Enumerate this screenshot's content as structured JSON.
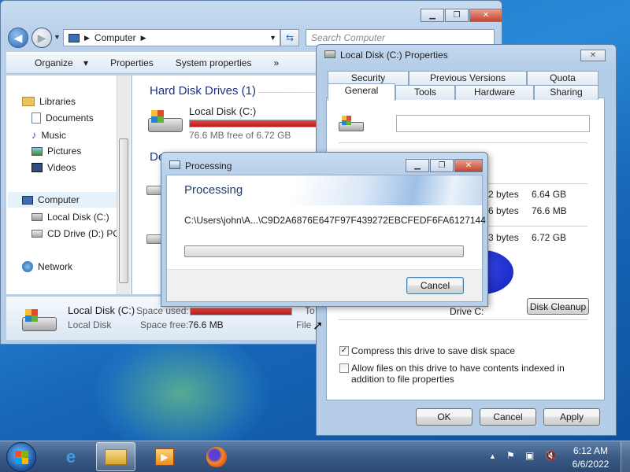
{
  "explorer": {
    "address_crumb": "Computer",
    "search_placeholder": "Search Computer",
    "toolbar": {
      "organize": "Organize",
      "properties": "Properties",
      "system_properties": "System properties",
      "more": "»"
    },
    "nav": {
      "libraries": "Libraries",
      "documents": "Documents",
      "music": "Music",
      "pictures": "Pictures",
      "videos": "Videos",
      "computer": "Computer",
      "local_disk": "Local Disk (C:)",
      "cd_drive": "CD Drive (D:) PCI",
      "network": "Network"
    },
    "hard_disk_group": "Hard Disk Drives (1)",
    "devices_group_partial": "De",
    "disk_name": "Local Disk (C:)",
    "disk_free": "76.6 MB free of 6.72 GB",
    "disk_usage_fraction": 0.99,
    "details": {
      "name": "Local Disk (C:)",
      "type": "Local Disk",
      "space_used_label": "Space used:",
      "space_free_label": "Space free:",
      "space_free_value": "76.6 MB",
      "fs_partial": "File",
      "to_partial": "To"
    }
  },
  "properties": {
    "title": "Local Disk (C:) Properties",
    "tabs_top": [
      "Security",
      "Previous Versions",
      "Quota"
    ],
    "tabs_bottom": [
      "General",
      "Tools",
      "Hardware",
      "Sharing"
    ],
    "name_value": "",
    "used_bytes_partial": "2 bytes",
    "used_size": "6.64 GB",
    "free_bytes_partial": "6 bytes",
    "free_size": "76.6 MB",
    "capacity_bytes_partial": "3 bytes",
    "capacity_size": "6.72 GB",
    "drive_label": "Drive C:",
    "disk_cleanup": "Disk Cleanup",
    "compress_label": "Compress this drive to save disk space",
    "compress_checked": true,
    "index_label": "Allow files on this drive to have contents indexed in addition to file properties",
    "index_checked": false,
    "ok": "OK",
    "cancel": "Cancel",
    "apply": "Apply"
  },
  "processing": {
    "title": "Processing",
    "heading": "Processing",
    "path": "C:\\Users\\john\\A...\\C9D2A6876E647F97F439272EBCFEDF6FA6127144",
    "progress": 0,
    "cancel": "Cancel"
  },
  "taskbar": {
    "time": "6:12 AM",
    "date": "6/6/2022"
  },
  "colors": {
    "disk_bar": "#c8262a",
    "pie_used": "#1f2fd6",
    "accent": "#3c7fb1"
  }
}
